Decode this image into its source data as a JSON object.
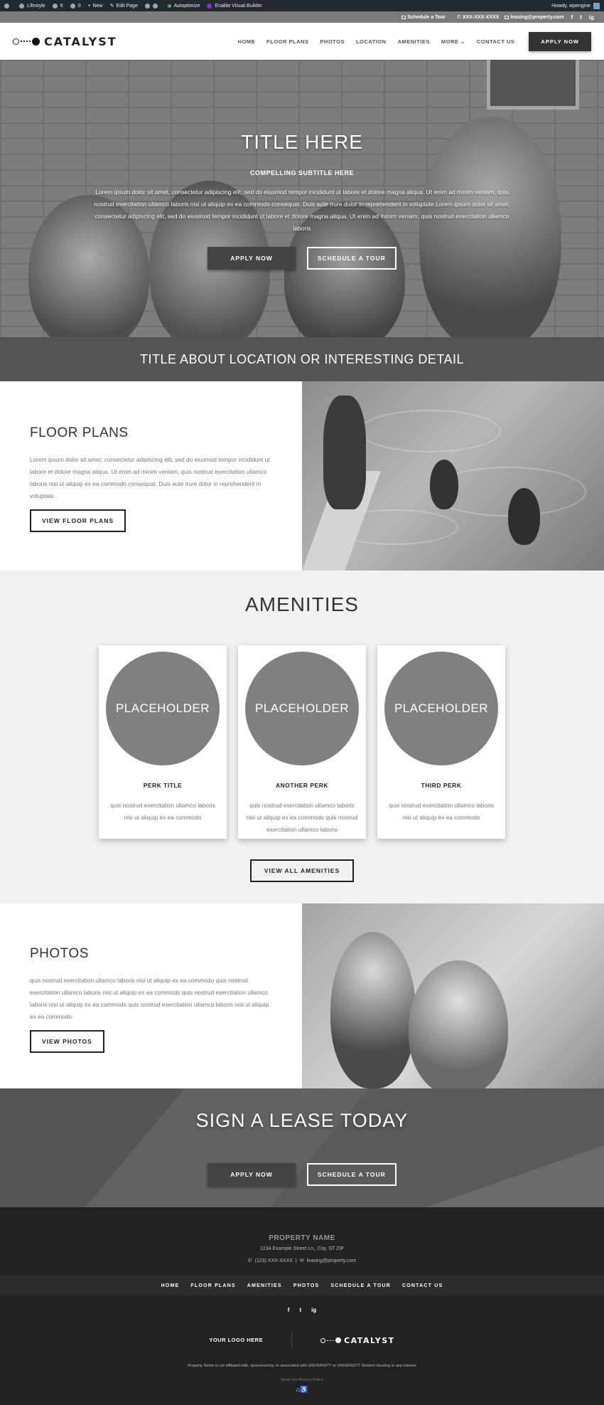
{
  "admin_bar": {
    "site_name": "Lifestyle",
    "updates_count": "6",
    "comments_count": "0",
    "new_label": "New",
    "edit_page_label": "Edit Page",
    "autoptimize_label": "Autoptimize",
    "visual_builder_label": "Enable Visual Builder",
    "howdy_label": "Howdy, wpengine"
  },
  "top_bar": {
    "schedule": "Schedule a Tour",
    "phone": "XXX-XXX-XXXX",
    "email": "leasing@property.com",
    "social": [
      "f",
      "t",
      "ig"
    ]
  },
  "header": {
    "logo_text": "CATALYST",
    "nav": [
      "HOME",
      "FLOOR PLANS",
      "PHOTOS",
      "LOCATION",
      "AMENITIES",
      "MORE",
      "CONTACT US"
    ],
    "more_chevron": "⌄",
    "apply_button": "APPLY NOW"
  },
  "hero": {
    "title": "TITLE HERE",
    "subtitle": "COMPELLING SUBTITLE HERE",
    "body": "Lorem ipsum dolor sit amet, consectetur adipiscing elit, sed do eiusmod tempor incididunt ut labore et dolore magna aliqua. Ut enim ad minim veniam, quis nostrud exercitation ullamco laboris nisi ut aliquip ex ea commodo consequat. Duis aute irure dolor in reprehenderit in voluptate Lorem ipsum dolor sit amet, consectetur adipiscing elit, sed do eiusmod tempor incididunt ut labore et dolore magna aliqua. Ut enim ad minim veniam, quis nostrud exercitation ullamco laboris",
    "apply_button": "APPLY NOW",
    "tour_button": "SCHEDULE A TOUR"
  },
  "band": {
    "title": "TITLE ABOUT LOCATION OR INTERESTING DETAIL"
  },
  "floor_plans": {
    "title": "FLOOR PLANS",
    "body": "Lorem ipsum dolor sit amet, consectetur adipiscing elit, sed do eiusmod tempor incididunt ut labore et dolore magna aliqua. Ut enim ad minim veniam, quis nostrud exercitation ullamco laboris nisi ut aliquip ex ea commodo consequat. Duis aute irure dolor in reprehenderit in voluptate",
    "button": "VIEW FLOOR PLANS"
  },
  "amenities": {
    "title": "AMENITIES",
    "cards": [
      {
        "placeholder": "PLACEHOLDER",
        "title": "PERK TITLE",
        "desc": "quis nostrud exercitation ullamco laboris nisi ut aliquip ex ea commodo"
      },
      {
        "placeholder": "PLACEHOLDER",
        "title": "ANOTHER PERK",
        "desc": "quis nostrud exercitation ullamco laboris nisi ut aliquip ex ea commodo quis nostrud exercitation ullamco laboris"
      },
      {
        "placeholder": "PLACEHOLDER",
        "title": "THIRD PERK",
        "desc": "quis nostrud exercitation ullamco laboris nisi ut aliquip ex ea commodo"
      }
    ],
    "button": "VIEW ALL AMENITIES"
  },
  "photos": {
    "title": "PHOTOS",
    "body": "quis nostrud exercitation ullamco laboris nisi ut aliquip ex ea commodo quis nostrud exercitation ullamco laboris nisi ut aliquip ex ea commodo quis nostrud exercitation ullamco laboris nisi ut aliquip ex ea commodo quis nostrud exercitation ullamco laboris nisi ut aliquip ex ea commodo",
    "button": "VIEW PHOTOS"
  },
  "cta": {
    "title": "SIGN A LEASE TODAY",
    "apply_button": "APPLY NOW",
    "tour_button": "SCHEDULE A TOUR"
  },
  "footer": {
    "property_name": "PROPERTY NAME",
    "address": "1234 Example Street Ln., City, ST ZIP",
    "phone": "(123) XXX-XXXX",
    "separator": "|",
    "email": "leasing@property.com",
    "nav": [
      "HOME",
      "FLOOR PLANS",
      "AMENITIES",
      "PHOTOS",
      "SCHEDULE A TOUR",
      "CONTACT US"
    ],
    "social": [
      "f",
      "t",
      "ig"
    ],
    "your_logo": "YOUR LOGO HERE",
    "logo_text": "CATALYST",
    "disclaimer": "Property Name is not affiliated with, sponsored by, or associated with UNIVERSITY or UNIVERSITY Student Housing in any manner",
    "privacy": "Read Our Privacy Policy",
    "accessibility_icons": "⌂♿"
  },
  "colors": {
    "admin_bar_bg": "#23282d",
    "top_bar_bg": "#7a7a7a",
    "band_bg": "#545454",
    "footer_bg": "#222222",
    "placeholder_circle": "#808080"
  }
}
